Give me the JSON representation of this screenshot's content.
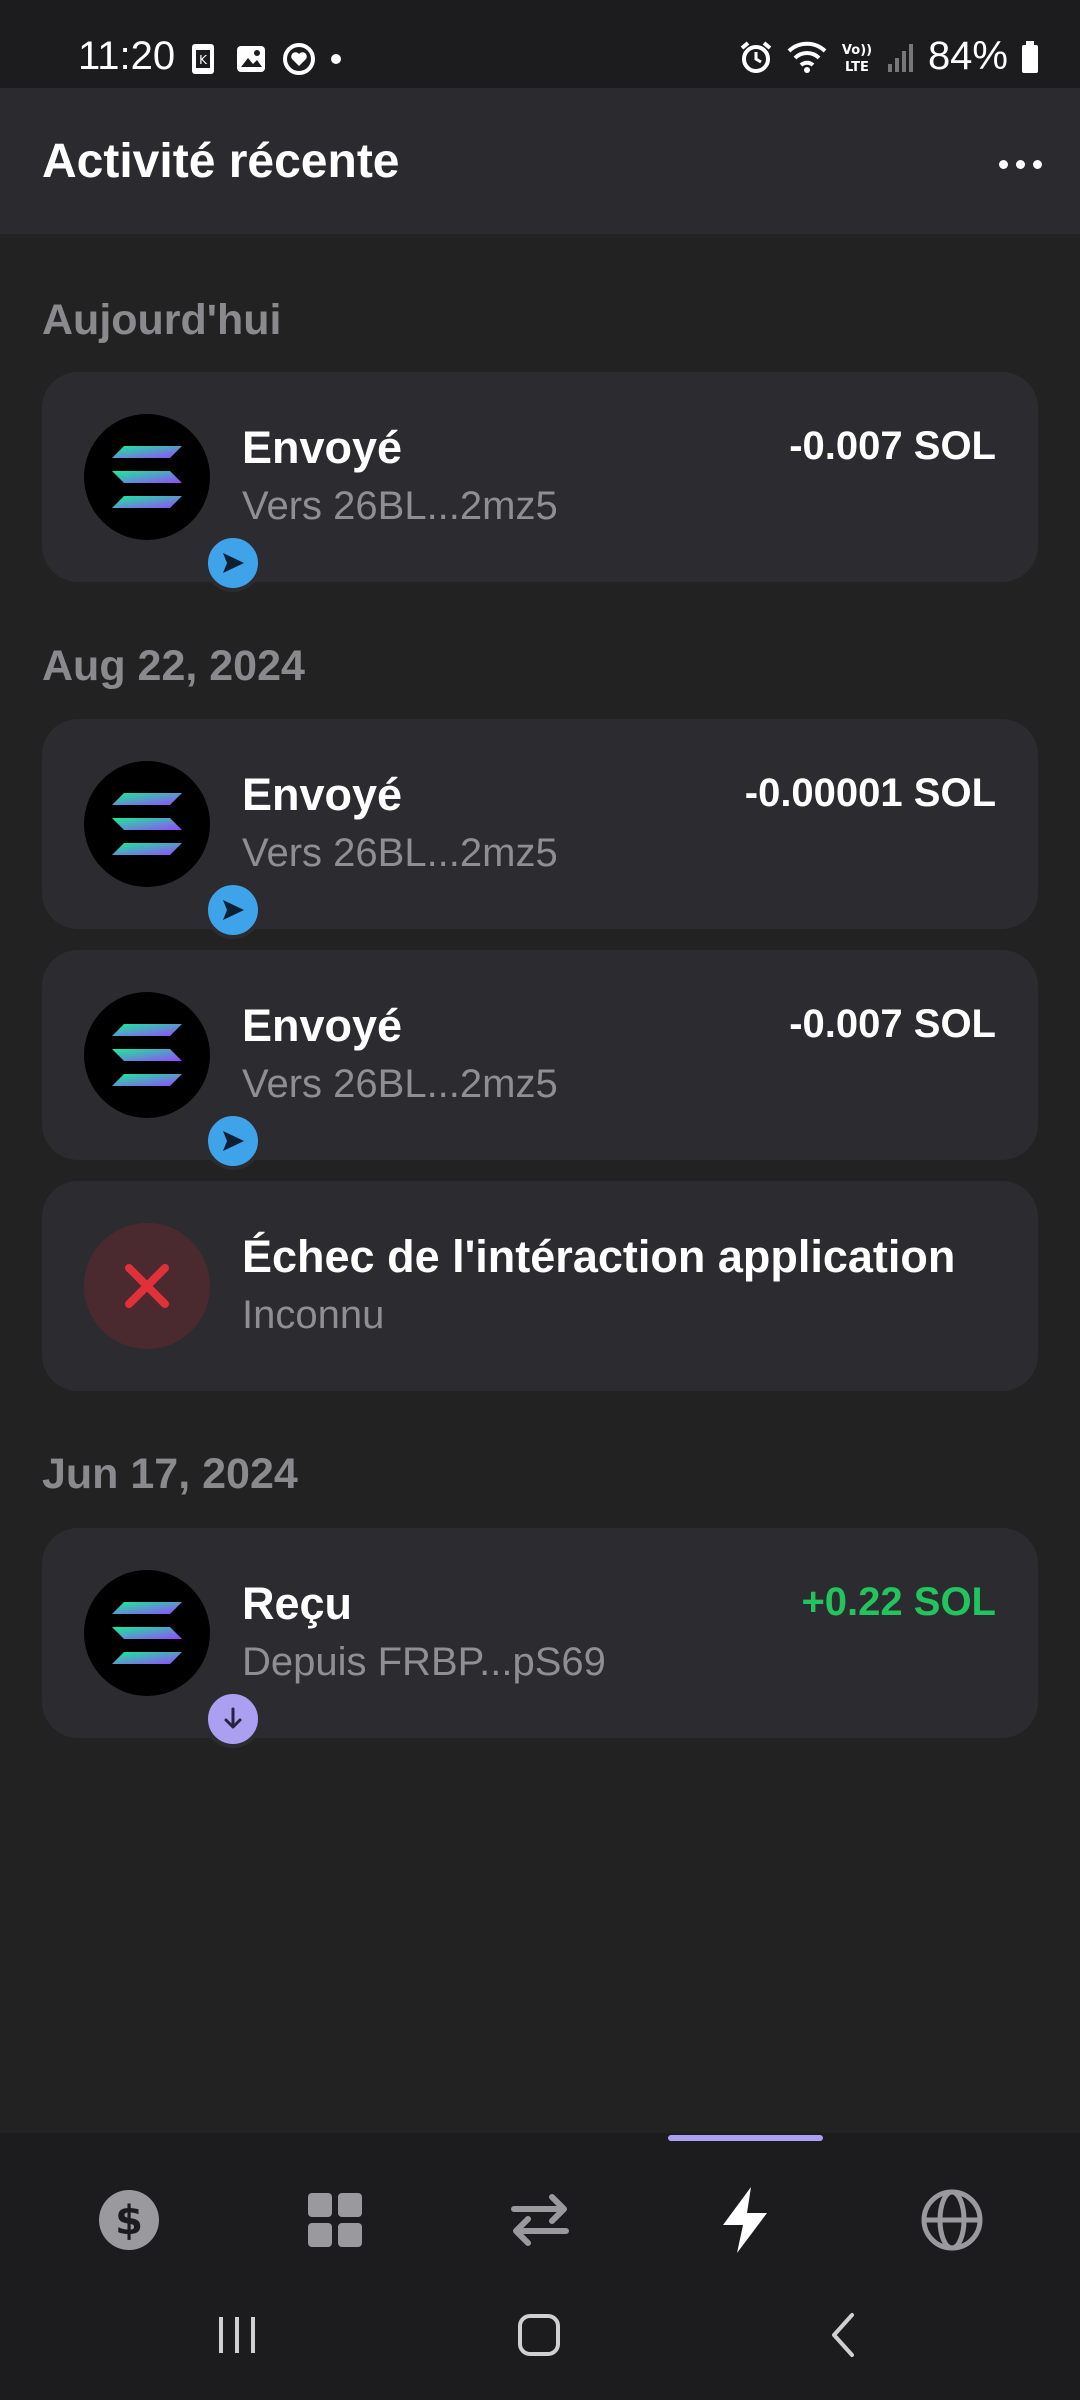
{
  "status_bar": {
    "time": "11:20",
    "battery": "84%"
  },
  "header": {
    "title": "Activité récente"
  },
  "sections": [
    {
      "label": "Aujourd'hui"
    },
    {
      "label": "Aug 22, 2024"
    },
    {
      "label": "Jun 17, 2024"
    }
  ],
  "transactions": [
    {
      "title": "Envoyé",
      "subtitle": "Vers 26BL...2mz5",
      "amount": "-0.007 SOL",
      "type": "sent"
    },
    {
      "title": "Envoyé",
      "subtitle": "Vers 26BL...2mz5",
      "amount": "-0.00001 SOL",
      "type": "sent"
    },
    {
      "title": "Envoyé",
      "subtitle": "Vers 26BL...2mz5",
      "amount": "-0.007 SOL",
      "type": "sent"
    },
    {
      "title": "Échec de l'intéraction application",
      "subtitle": "Inconnu",
      "amount": "",
      "type": "failed"
    },
    {
      "title": "Reçu",
      "subtitle": "Depuis FRBP...pS69",
      "amount": "+0.22 SOL",
      "type": "received"
    }
  ],
  "bottom_nav": {
    "items": [
      "dollar-icon",
      "grid-icon",
      "swap-icon",
      "lightning-icon",
      "globe-icon"
    ],
    "active": "lightning-icon",
    "accent": "#ab9ff2"
  },
  "colors": {
    "positive": "#21c45d",
    "sent_badge": "#3fa3ea",
    "failed": "#e0313b"
  }
}
